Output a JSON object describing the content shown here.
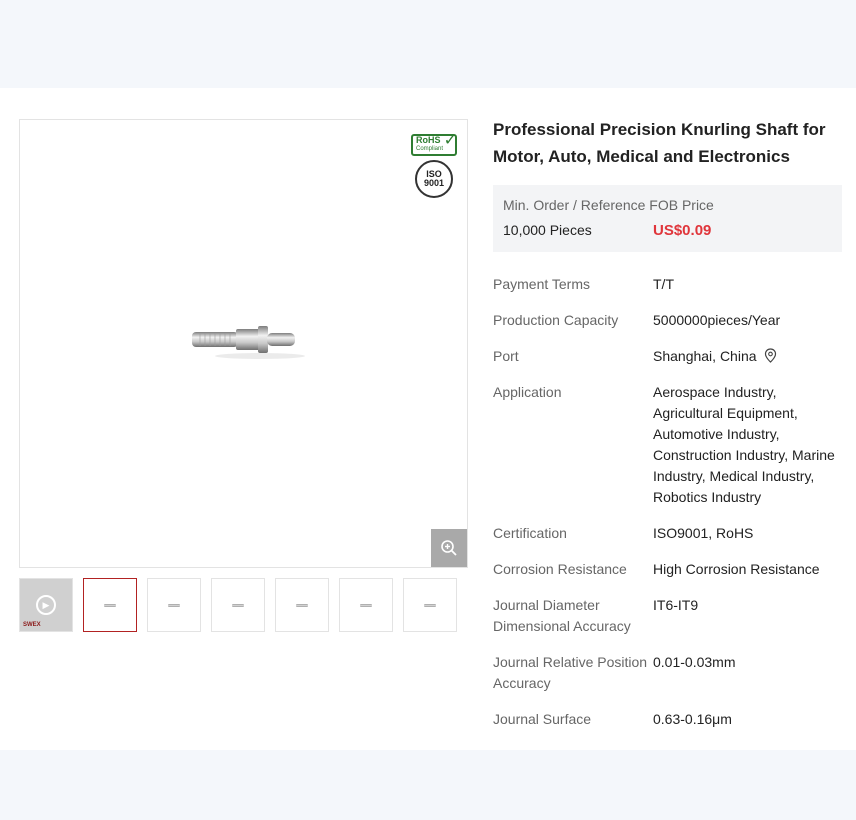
{
  "product": {
    "title": "Professional Precision Knurling Shaft for Motor, Auto, Medical and Electronics",
    "badges": {
      "rohs_line1": "RoHS",
      "rohs_line2": "Compliant",
      "iso_line1": "ISO",
      "iso_line2": "9001"
    }
  },
  "gallery": {
    "thumbnail_count": 7,
    "video_logo": "SWEX",
    "zoom_icon": "zoom-in-icon"
  },
  "pricing": {
    "header": "Min. Order / Reference FOB Price",
    "min_order": "10,000 Pieces",
    "price": "US$0.09",
    "price_color": "#e0353b"
  },
  "specs": [
    {
      "key": "Payment Terms",
      "value": "T/T"
    },
    {
      "key": "Production Capacity",
      "value": "5000000pieces/Year"
    },
    {
      "key": "Port",
      "value": "Shanghai, China"
    },
    {
      "key": "Application",
      "value": "Aerospace Industry, Agricultural Equipment, Automotive Industry, Construction Industry, Marine Industry, Medical Industry, Robotics Industry"
    },
    {
      "key": "Certification",
      "value": "ISO9001, RoHS"
    },
    {
      "key": "Corrosion Resistance",
      "value": "High Corrosion Resistance"
    },
    {
      "key": "Journal Diameter Dimensional Accuracy",
      "value": "IT6-IT9"
    },
    {
      "key": "Journal Relative Position Accuracy",
      "value": "0.01-0.03mm"
    },
    {
      "key": "Journal Surface",
      "value": "0.63-0.16μm"
    }
  ]
}
